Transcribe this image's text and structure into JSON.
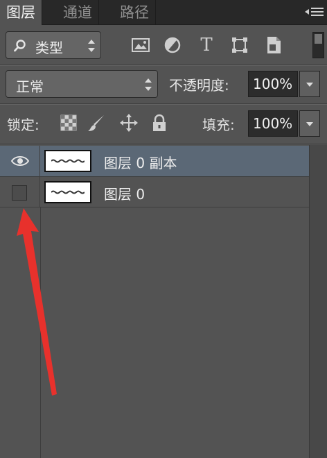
{
  "tabs": [
    {
      "label": "图层",
      "active": true
    },
    {
      "label": "通道",
      "active": false
    },
    {
      "label": "路径",
      "active": false
    }
  ],
  "filter": {
    "select_label": "类型",
    "icons": [
      "image-filter-icon",
      "adjustment-filter-icon",
      "text-filter-icon",
      "shape-filter-icon",
      "smart-object-filter-icon"
    ],
    "text_icon_glyph": "T"
  },
  "blend": {
    "mode": "正常",
    "opacity_label": "不透明度:",
    "opacity_value": "100%"
  },
  "lock": {
    "label": "锁定:",
    "icons": [
      "lock-transparent-pixels-icon",
      "lock-image-pixels-icon",
      "lock-position-icon",
      "lock-all-icon"
    ],
    "fill_label": "填充:",
    "fill_value": "100%"
  },
  "layers": [
    {
      "name": "图层 0 副本",
      "visible": true,
      "selected": true
    },
    {
      "name": "图层 0",
      "visible": false,
      "selected": false
    }
  ],
  "colors": {
    "selected_row": "#5b6876",
    "panel_bg": "#535353",
    "annotation_arrow": "#e8312c"
  }
}
